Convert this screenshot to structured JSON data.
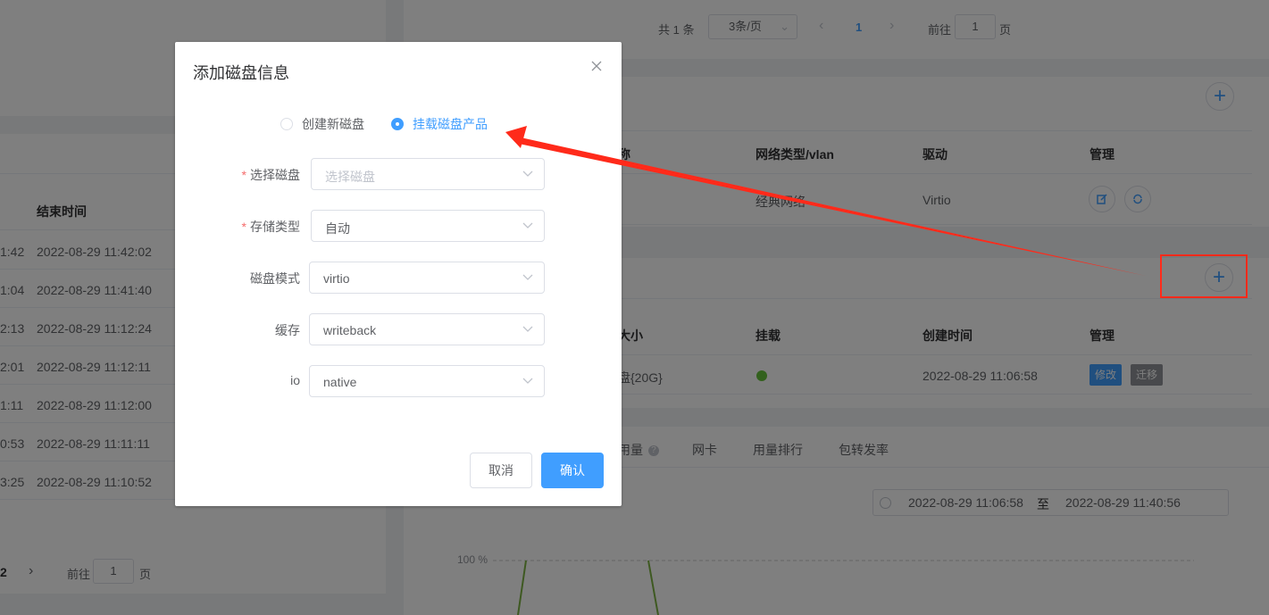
{
  "left_panel": {
    "col_header_end": "结束时间",
    "rows": [
      {
        "start_tail": "1:42",
        "end": "2022-08-29 11:42:02"
      },
      {
        "start_tail": "1:04",
        "end": "2022-08-29 11:41:40"
      },
      {
        "start_tail": "2:13",
        "end": "2022-08-29 11:12:24"
      },
      {
        "start_tail": "2:01",
        "end": "2022-08-29 11:12:11"
      },
      {
        "start_tail": "1:11",
        "end": "2022-08-29 11:12:00"
      },
      {
        "start_tail": "0:53",
        "end": "2022-08-29 11:11:11"
      },
      {
        "start_tail": "3:25",
        "end": "2022-08-29 11:10:52"
      }
    ],
    "pager": {
      "page_tail": "2",
      "goto_label": "前往",
      "goto_value": "1",
      "page_label": "页"
    }
  },
  "top_pager": {
    "total": "共 1 条",
    "page_size": "3条/页",
    "current_page": "1",
    "goto_label": "前往",
    "goto_value": "1",
    "page_label": "页"
  },
  "network_section": {
    "headers": [
      "称",
      "网络类型/vlan",
      "驱动",
      "管理"
    ],
    "row": {
      "net_type": "经典网络",
      "driver": "Virtio"
    }
  },
  "disk_section": {
    "headers": [
      "大小",
      "挂载",
      "创建时间",
      "管理"
    ],
    "row": {
      "size": "盘{20G}",
      "created": "2022-08-29 11:06:58",
      "edit": "修改",
      "migrate": "迁移"
    }
  },
  "monitor": {
    "tabs": [
      "用量",
      "网卡",
      "用量排行",
      "包转发率"
    ],
    "range_start": "2022-08-29 11:06:58",
    "range_to": "至",
    "range_end": "2022-08-29 11:40:56",
    "y_label": "100 %"
  },
  "dialog": {
    "title": "添加磁盘信息",
    "radio_options": [
      {
        "label": "创建新磁盘",
        "checked": false
      },
      {
        "label": "挂载磁盘产品",
        "checked": true
      }
    ],
    "fields": [
      {
        "label": "选择磁盘",
        "required": true,
        "value": "选择磁盘",
        "placeholder": true
      },
      {
        "label": "存储类型",
        "required": true,
        "value": "自动",
        "placeholder": false
      },
      {
        "label": "磁盘模式",
        "required": false,
        "value": "virtio",
        "placeholder": false
      },
      {
        "label": "缓存",
        "required": false,
        "value": "writeback",
        "placeholder": false
      },
      {
        "label": "io",
        "required": false,
        "value": "native",
        "placeholder": false
      }
    ],
    "cancel_label": "取消",
    "confirm_label": "确认",
    "required_mark": "*"
  },
  "colors": {
    "primary": "#409eff",
    "annotation_red": "#ff2a1a",
    "migrate_gray": "#909399",
    "edit_blue": "#409eff",
    "mount_green": "#67c23a",
    "chart_line": "#7cb342"
  }
}
